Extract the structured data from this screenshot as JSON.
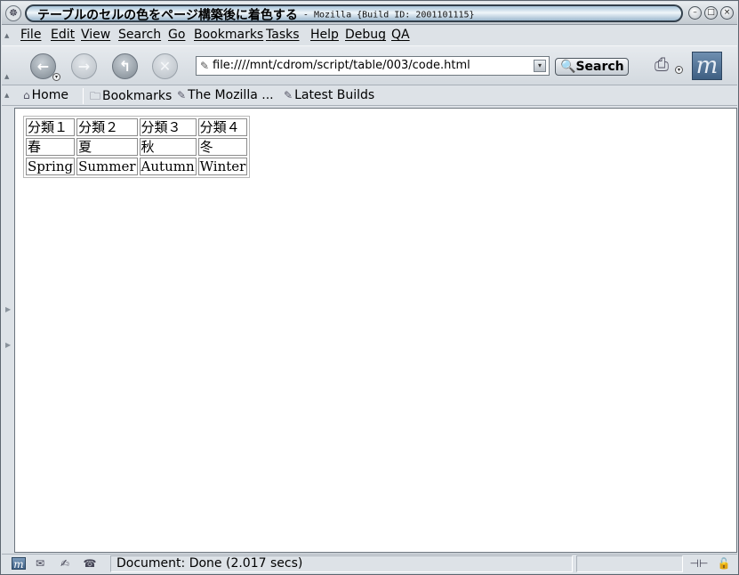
{
  "window": {
    "title_jp": "テーブルのセルの色をページ構築後に着色する",
    "title_suffix": " - Mozilla {Build ID: 2001101115}"
  },
  "menubar": {
    "items": [
      "File",
      "Edit",
      "View",
      "Search",
      "Go",
      "Bookmarks",
      "Tasks",
      "Help",
      "Debug",
      "QA"
    ]
  },
  "navigation": {
    "url": "file:////mnt/cdrom/script/table/003/code.html",
    "search_label": "Search"
  },
  "personal_toolbar": {
    "items": [
      "Home",
      "Bookmarks",
      "The Mozilla ...",
      "Latest Builds"
    ]
  },
  "table": {
    "rows": [
      [
        "分類１",
        "分類２",
        "分類３",
        "分類４"
      ],
      [
        "春",
        "夏",
        "秋",
        "冬"
      ],
      [
        "Spring",
        "Summer",
        "Autumn",
        "Winter"
      ]
    ]
  },
  "statusbar": {
    "text": "Document: Done (2.017 secs)"
  },
  "icons": {
    "window_menu": "mozilla-icon",
    "back": "back-arrow-icon",
    "forward": "forward-arrow-icon",
    "reload": "reload-icon",
    "stop": "stop-icon",
    "print": "print-icon",
    "logo": "mozilla-m-logo"
  }
}
